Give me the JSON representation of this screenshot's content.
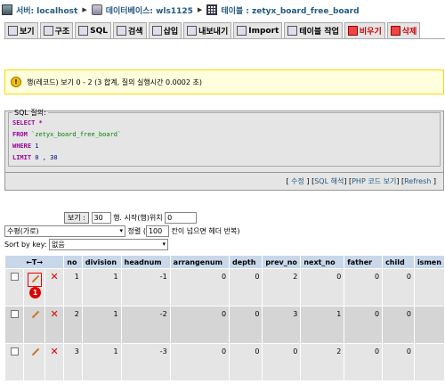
{
  "breadcrumb": {
    "server_label": "서버: localhost",
    "db_label": "데이터베이스: wls1125",
    "table_label": "테이블 : zetyx_board_free_board"
  },
  "tabs": [
    {
      "label": "보기",
      "icon": "browse-icon"
    },
    {
      "label": "구조",
      "icon": "structure-icon"
    },
    {
      "label": "SQL",
      "icon": "sql-icon"
    },
    {
      "label": "검색",
      "icon": "search-icon"
    },
    {
      "label": "삽입",
      "icon": "insert-icon"
    },
    {
      "label": "내보내기",
      "icon": "export-icon"
    },
    {
      "label": "Import",
      "icon": "import-icon"
    },
    {
      "label": "테이블 작업",
      "icon": "operations-icon"
    },
    {
      "label": "비우기",
      "icon": "empty-icon"
    },
    {
      "label": "삭제",
      "icon": "drop-icon"
    }
  ],
  "notice": {
    "icon": "warning-icon",
    "text": "행(레코드) 보기 0 - 2 (3 합계, 질의 실행시간 0.0002 초)"
  },
  "sql": {
    "legend": "SQL 질의:",
    "select_kw": "SELECT",
    "select_val": "*",
    "from_kw": "FROM",
    "from_val": "`zetyx_board_free_board`",
    "where_kw": "WHERE",
    "where_val": "1",
    "limit_kw": "LIMIT",
    "limit_val": "0 , 30",
    "links": {
      "open": "[",
      "edit": "수정",
      "explain": "SQL 해석",
      "php": "PHP 코드 보기",
      "refresh": "Refresh",
      "sep": "] [",
      "close": "]"
    }
  },
  "controls": {
    "show_button": "보기 :",
    "rows_value": "30",
    "start_label": "행. 시작(행)위치",
    "start_value": "0",
    "mode_value": "수평(가로)",
    "mode_suffix": "정렬",
    "repeat_value": "100",
    "repeat_suffix": "칸이 넘으면 헤더 반복)",
    "sort_label": "Sort by key:",
    "sort_value": "없음"
  },
  "table": {
    "nav_arrows": "←T→",
    "columns": [
      "no",
      "division",
      "headnum",
      "arrangenum",
      "depth",
      "prev_no",
      "next_no",
      "father",
      "child",
      "ismen"
    ],
    "rows": [
      [
        "1",
        "1",
        "-1",
        "0",
        "0",
        "2",
        "0",
        "0",
        "0",
        ""
      ],
      [
        "2",
        "1",
        "-2",
        "0",
        "0",
        "3",
        "1",
        "0",
        "0",
        ""
      ],
      [
        "3",
        "1",
        "-3",
        "0",
        "0",
        "0",
        "2",
        "0",
        "0",
        ""
      ]
    ]
  },
  "annotation_badge": "1",
  "colors": {
    "header_bg": "#c8d8ea",
    "row_odd": "#e5e5e5",
    "row_even": "#d5d5d5",
    "notice_bg": "#ffffdd",
    "highlight": "#e00000"
  }
}
